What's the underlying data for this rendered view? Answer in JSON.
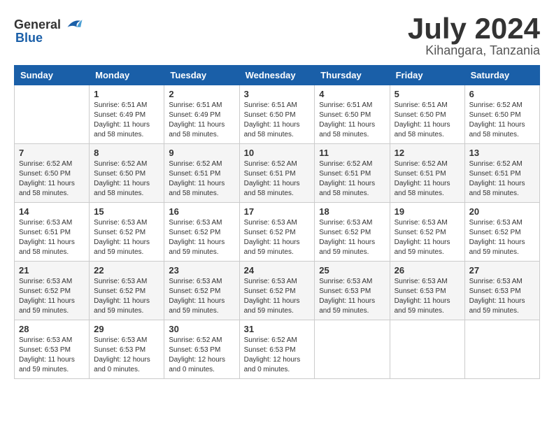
{
  "header": {
    "logo_general": "General",
    "logo_blue": "Blue",
    "month": "July 2024",
    "location": "Kihangara, Tanzania"
  },
  "days_of_week": [
    "Sunday",
    "Monday",
    "Tuesday",
    "Wednesday",
    "Thursday",
    "Friday",
    "Saturday"
  ],
  "weeks": [
    [
      {
        "day": "",
        "info": ""
      },
      {
        "day": "1",
        "info": "Sunrise: 6:51 AM\nSunset: 6:49 PM\nDaylight: 11 hours and 58 minutes."
      },
      {
        "day": "2",
        "info": "Sunrise: 6:51 AM\nSunset: 6:49 PM\nDaylight: 11 hours and 58 minutes."
      },
      {
        "day": "3",
        "info": "Sunrise: 6:51 AM\nSunset: 6:50 PM\nDaylight: 11 hours and 58 minutes."
      },
      {
        "day": "4",
        "info": "Sunrise: 6:51 AM\nSunset: 6:50 PM\nDaylight: 11 hours and 58 minutes."
      },
      {
        "day": "5",
        "info": "Sunrise: 6:51 AM\nSunset: 6:50 PM\nDaylight: 11 hours and 58 minutes."
      },
      {
        "day": "6",
        "info": "Sunrise: 6:52 AM\nSunset: 6:50 PM\nDaylight: 11 hours and 58 minutes."
      }
    ],
    [
      {
        "day": "7",
        "info": "Sunrise: 6:52 AM\nSunset: 6:50 PM\nDaylight: 11 hours and 58 minutes."
      },
      {
        "day": "8",
        "info": "Sunrise: 6:52 AM\nSunset: 6:50 PM\nDaylight: 11 hours and 58 minutes."
      },
      {
        "day": "9",
        "info": "Sunrise: 6:52 AM\nSunset: 6:51 PM\nDaylight: 11 hours and 58 minutes."
      },
      {
        "day": "10",
        "info": "Sunrise: 6:52 AM\nSunset: 6:51 PM\nDaylight: 11 hours and 58 minutes."
      },
      {
        "day": "11",
        "info": "Sunrise: 6:52 AM\nSunset: 6:51 PM\nDaylight: 11 hours and 58 minutes."
      },
      {
        "day": "12",
        "info": "Sunrise: 6:52 AM\nSunset: 6:51 PM\nDaylight: 11 hours and 58 minutes."
      },
      {
        "day": "13",
        "info": "Sunrise: 6:52 AM\nSunset: 6:51 PM\nDaylight: 11 hours and 58 minutes."
      }
    ],
    [
      {
        "day": "14",
        "info": "Sunrise: 6:53 AM\nSunset: 6:51 PM\nDaylight: 11 hours and 58 minutes."
      },
      {
        "day": "15",
        "info": "Sunrise: 6:53 AM\nSunset: 6:52 PM\nDaylight: 11 hours and 59 minutes."
      },
      {
        "day": "16",
        "info": "Sunrise: 6:53 AM\nSunset: 6:52 PM\nDaylight: 11 hours and 59 minutes."
      },
      {
        "day": "17",
        "info": "Sunrise: 6:53 AM\nSunset: 6:52 PM\nDaylight: 11 hours and 59 minutes."
      },
      {
        "day": "18",
        "info": "Sunrise: 6:53 AM\nSunset: 6:52 PM\nDaylight: 11 hours and 59 minutes."
      },
      {
        "day": "19",
        "info": "Sunrise: 6:53 AM\nSunset: 6:52 PM\nDaylight: 11 hours and 59 minutes."
      },
      {
        "day": "20",
        "info": "Sunrise: 6:53 AM\nSunset: 6:52 PM\nDaylight: 11 hours and 59 minutes."
      }
    ],
    [
      {
        "day": "21",
        "info": "Sunrise: 6:53 AM\nSunset: 6:52 PM\nDaylight: 11 hours and 59 minutes."
      },
      {
        "day": "22",
        "info": "Sunrise: 6:53 AM\nSunset: 6:52 PM\nDaylight: 11 hours and 59 minutes."
      },
      {
        "day": "23",
        "info": "Sunrise: 6:53 AM\nSunset: 6:52 PM\nDaylight: 11 hours and 59 minutes."
      },
      {
        "day": "24",
        "info": "Sunrise: 6:53 AM\nSunset: 6:52 PM\nDaylight: 11 hours and 59 minutes."
      },
      {
        "day": "25",
        "info": "Sunrise: 6:53 AM\nSunset: 6:53 PM\nDaylight: 11 hours and 59 minutes."
      },
      {
        "day": "26",
        "info": "Sunrise: 6:53 AM\nSunset: 6:53 PM\nDaylight: 11 hours and 59 minutes."
      },
      {
        "day": "27",
        "info": "Sunrise: 6:53 AM\nSunset: 6:53 PM\nDaylight: 11 hours and 59 minutes."
      }
    ],
    [
      {
        "day": "28",
        "info": "Sunrise: 6:53 AM\nSunset: 6:53 PM\nDaylight: 11 hours and 59 minutes."
      },
      {
        "day": "29",
        "info": "Sunrise: 6:53 AM\nSunset: 6:53 PM\nDaylight: 12 hours and 0 minutes."
      },
      {
        "day": "30",
        "info": "Sunrise: 6:52 AM\nSunset: 6:53 PM\nDaylight: 12 hours and 0 minutes."
      },
      {
        "day": "31",
        "info": "Sunrise: 6:52 AM\nSunset: 6:53 PM\nDaylight: 12 hours and 0 minutes."
      },
      {
        "day": "",
        "info": ""
      },
      {
        "day": "",
        "info": ""
      },
      {
        "day": "",
        "info": ""
      }
    ]
  ]
}
